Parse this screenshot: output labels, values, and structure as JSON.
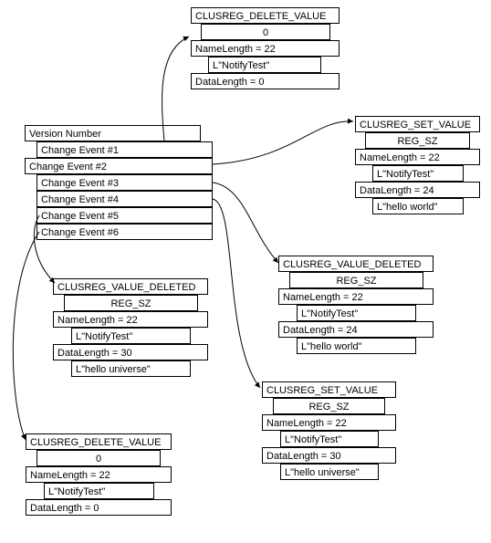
{
  "source": {
    "header": "Version Number",
    "events": [
      "Change Event #1",
      "Change Event #2",
      "Change Event #3",
      "Change Event #4",
      "Change Event #5",
      "Change Event #6"
    ]
  },
  "blocks": {
    "b1": {
      "title": "CLUSREG_DELETE_VALUE",
      "rows": [
        "0",
        "NameLength = 22",
        "L\"NotifyTest\"",
        "DataLength = 0"
      ]
    },
    "b2": {
      "title": "CLUSREG_SET_VALUE",
      "rows": [
        "REG_SZ",
        "NameLength = 22",
        "L\"NotifyTest\"",
        "DataLength = 24",
        "L\"hello world\""
      ]
    },
    "b3": {
      "title": "CLUSREG_VALUE_DELETED",
      "rows": [
        "REG_SZ",
        "NameLength = 22",
        "L\"NotifyTest\"",
        "DataLength = 24",
        "L\"hello world\""
      ]
    },
    "b4": {
      "title": "CLUSREG_SET_VALUE",
      "rows": [
        "REG_SZ",
        "NameLength = 22",
        "L\"NotifyTest\"",
        "DataLength = 30",
        "L\"hello universe\""
      ]
    },
    "b5": {
      "title": "CLUSREG_VALUE_DELETED",
      "rows": [
        "REG_SZ",
        "NameLength = 22",
        "L\"NotifyTest\"",
        "DataLength = 30",
        "L\"hello universe\""
      ]
    },
    "b6": {
      "title": "CLUSREG_DELETE_VALUE",
      "rows": [
        "0",
        "NameLength = 22",
        "L\"NotifyTest\"",
        "DataLength = 0"
      ]
    }
  }
}
